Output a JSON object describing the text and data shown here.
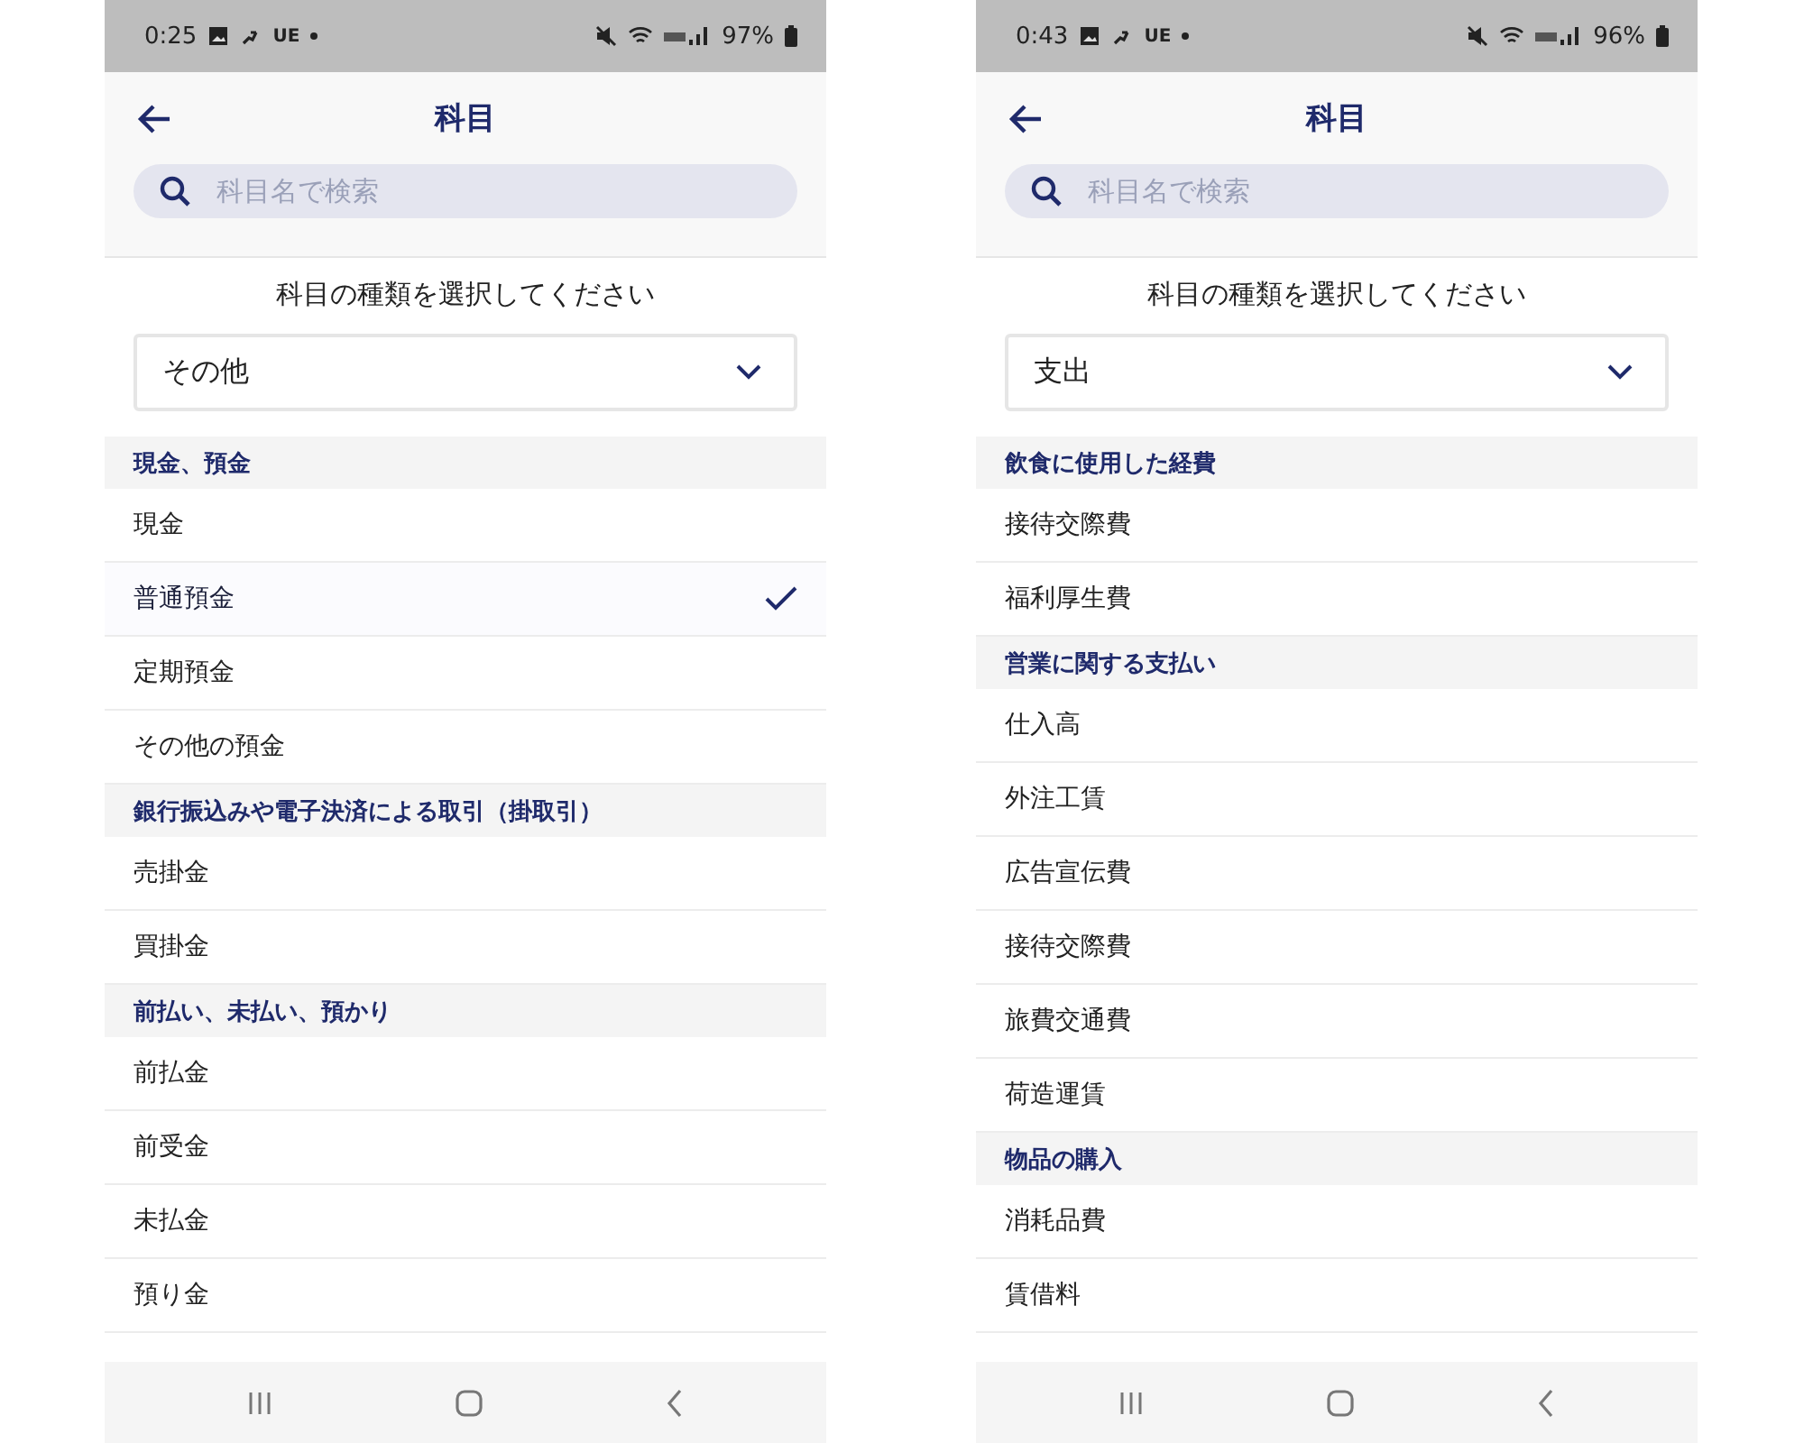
{
  "screens": [
    {
      "status_bar": {
        "time": "0:25",
        "carrier": "UE",
        "battery": "97%"
      },
      "title": "科目",
      "search": {
        "placeholder": "科目名で検索"
      },
      "prompt": "科目の種類を選択してください",
      "category_dropdown": {
        "value": "その他"
      },
      "sections": [
        {
          "heading": "現金、預金",
          "items": [
            {
              "label": "現金",
              "selected": false
            },
            {
              "label": "普通預金",
              "selected": true
            },
            {
              "label": "定期預金",
              "selected": false
            },
            {
              "label": "その他の預金",
              "selected": false
            }
          ]
        },
        {
          "heading": "銀行振込みや電子決済による取引（掛取引）",
          "items": [
            {
              "label": "売掛金",
              "selected": false
            },
            {
              "label": "買掛金",
              "selected": false
            }
          ]
        },
        {
          "heading": "前払い、未払い、預かり",
          "items": [
            {
              "label": "前払金",
              "selected": false
            },
            {
              "label": "前受金",
              "selected": false
            },
            {
              "label": "未払金",
              "selected": false
            },
            {
              "label": "預り金",
              "selected": false
            }
          ]
        }
      ]
    },
    {
      "status_bar": {
        "time": "0:43",
        "carrier": "UE",
        "battery": "96%"
      },
      "title": "科目",
      "search": {
        "placeholder": "科目名で検索"
      },
      "prompt": "科目の種類を選択してください",
      "category_dropdown": {
        "value": "支出"
      },
      "sections": [
        {
          "heading": "飲食に使用した経費",
          "items": [
            {
              "label": "接待交際費",
              "selected": false
            },
            {
              "label": "福利厚生費",
              "selected": false
            }
          ]
        },
        {
          "heading": "営業に関する支払い",
          "items": [
            {
              "label": "仕入高",
              "selected": false
            },
            {
              "label": "外注工賃",
              "selected": false
            },
            {
              "label": "広告宣伝費",
              "selected": false
            },
            {
              "label": "接待交際費",
              "selected": false
            },
            {
              "label": "旅費交通費",
              "selected": false
            },
            {
              "label": "荷造運賃",
              "selected": false
            }
          ]
        },
        {
          "heading": "物品の購入",
          "items": [
            {
              "label": "消耗品費",
              "selected": false
            },
            {
              "label": "賃借料",
              "selected": false
            }
          ]
        }
      ]
    }
  ]
}
